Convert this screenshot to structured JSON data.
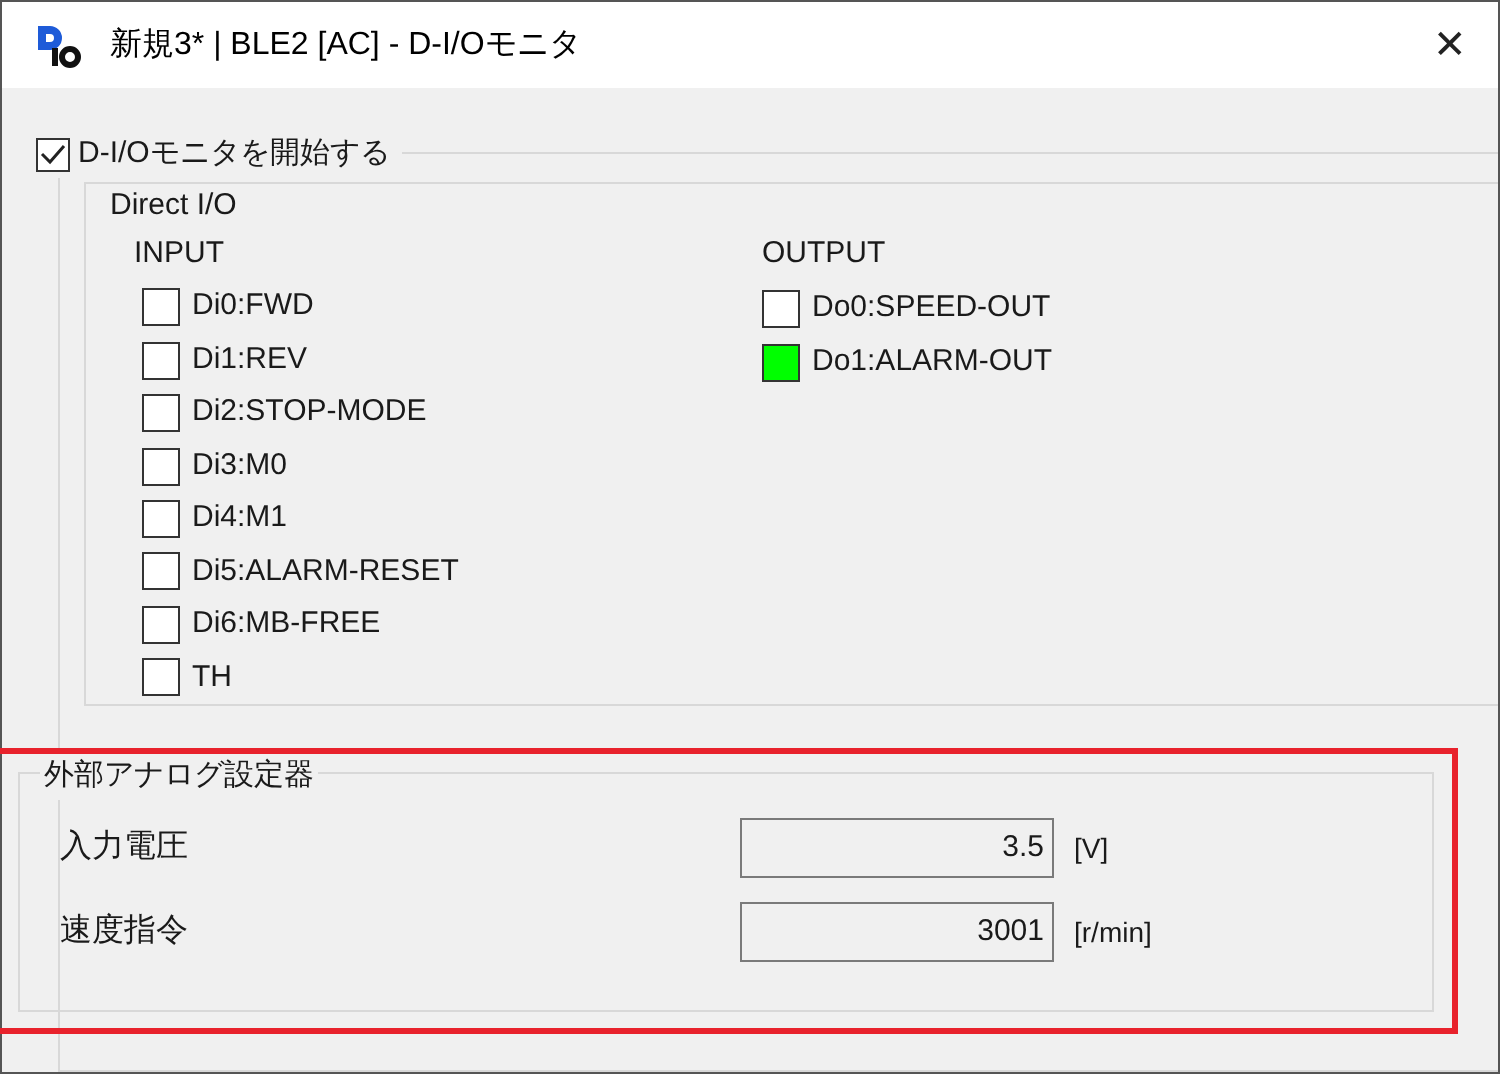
{
  "window": {
    "title": "新規3* | BLE2 [AC] - D-I/Oモニタ",
    "close": "✕"
  },
  "monitor": {
    "label": "D-I/Oモニタを開始する",
    "checked": true
  },
  "direct_io": {
    "title": "Direct I/O",
    "input": {
      "heading": "INPUT",
      "signals": [
        {
          "label": "Di0:FWD",
          "on": false
        },
        {
          "label": "Di1:REV",
          "on": false
        },
        {
          "label": "Di2:STOP-MODE",
          "on": false
        },
        {
          "label": "Di3:M0",
          "on": false
        },
        {
          "label": "Di4:M1",
          "on": false
        },
        {
          "label": "Di5:ALARM-RESET",
          "on": false
        },
        {
          "label": "Di6:MB-FREE",
          "on": false
        },
        {
          "label": "TH",
          "on": false
        }
      ]
    },
    "output": {
      "heading": "OUTPUT",
      "signals": [
        {
          "label": "Do0:SPEED-OUT",
          "on": false
        },
        {
          "label": "Do1:ALARM-OUT",
          "on": true
        }
      ]
    }
  },
  "analog": {
    "title": "外部アナログ設定器",
    "highlighted": true,
    "rows": [
      {
        "label": "入力電圧",
        "value": "3.5",
        "unit": "[V]"
      },
      {
        "label": "速度指令",
        "value": "3001",
        "unit": "[r/min]"
      }
    ]
  }
}
